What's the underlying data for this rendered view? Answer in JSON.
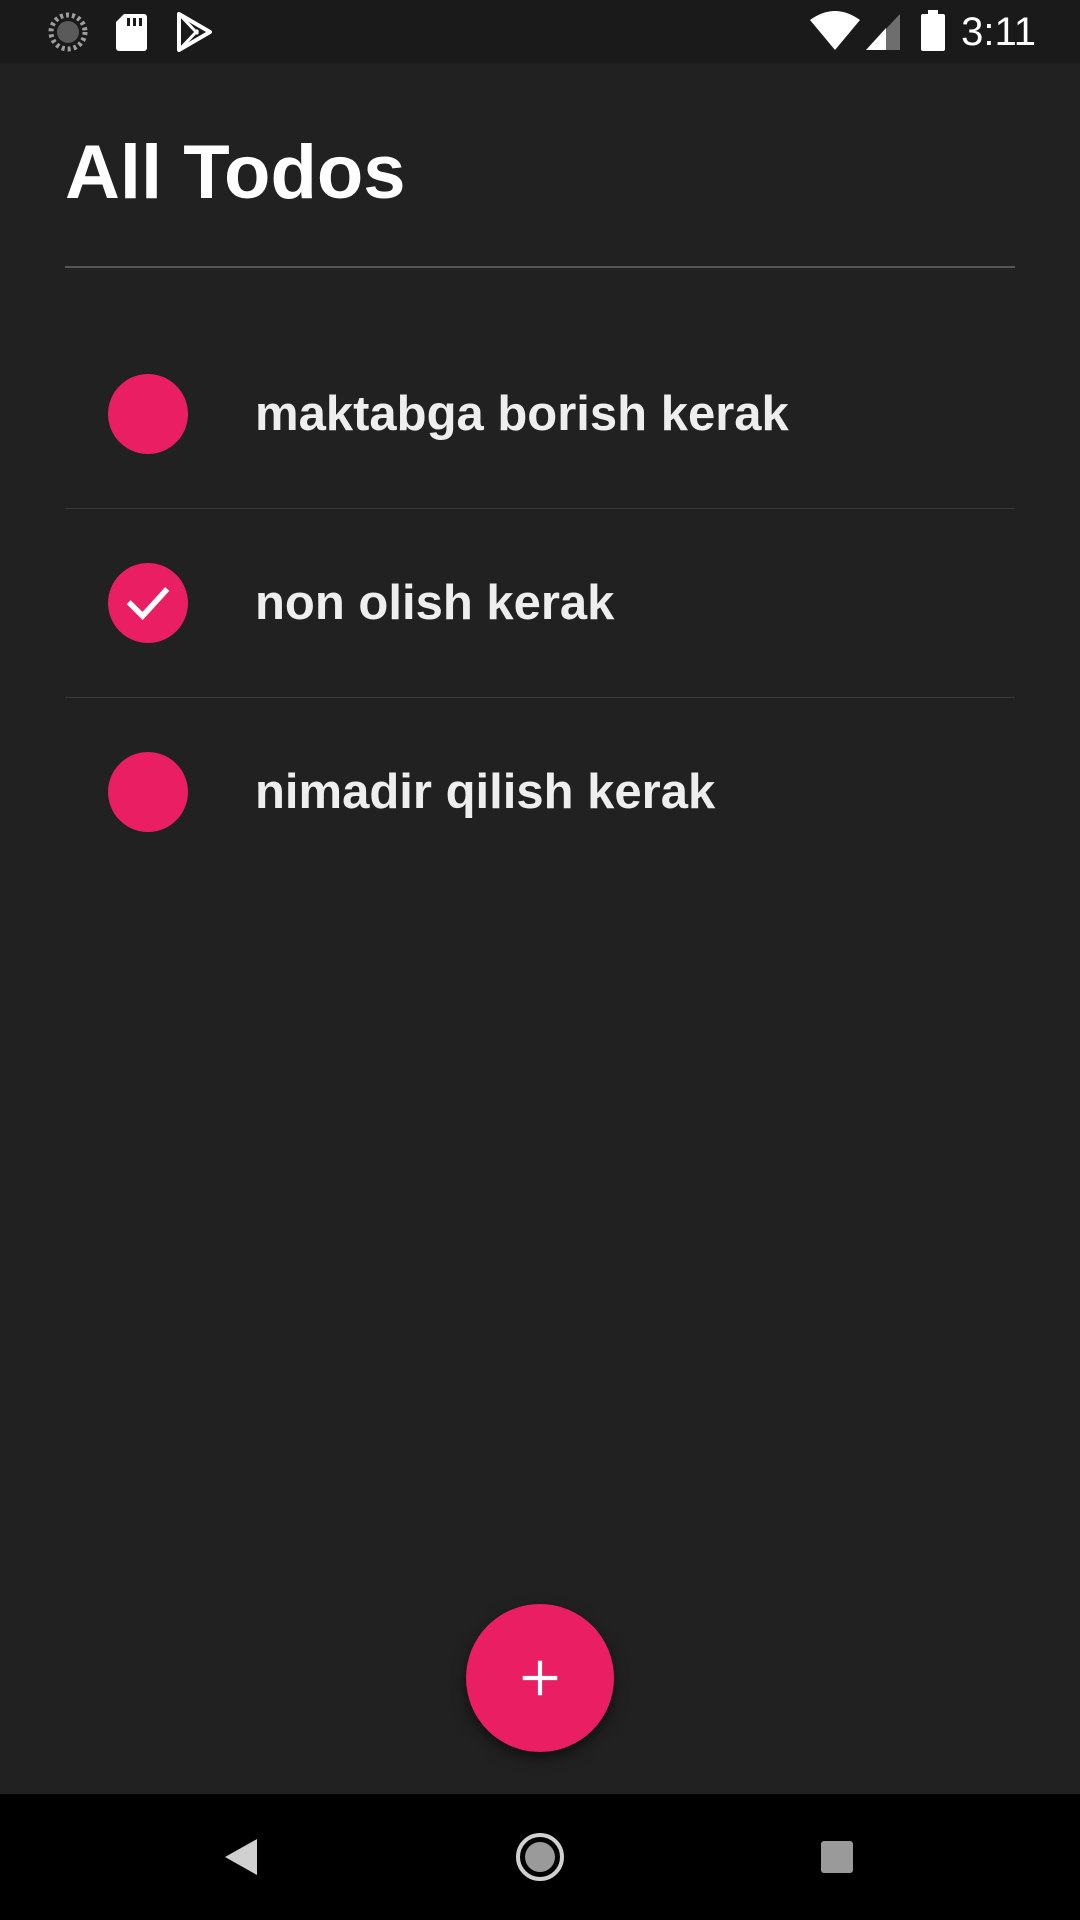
{
  "status_bar": {
    "time": "3:11",
    "left_icons": [
      "loading-icon",
      "sd-card-icon",
      "play-store-icon"
    ],
    "right_icons": [
      "wifi-icon",
      "cell-signal-icon",
      "battery-icon"
    ]
  },
  "header": {
    "title": "All Todos"
  },
  "todos": [
    {
      "text": "maktabga borish kerak",
      "done": false
    },
    {
      "text": "non olish kerak",
      "done": true
    },
    {
      "text": "nimadir qilish kerak",
      "done": false
    }
  ],
  "fab": {
    "icon": "plus-icon"
  },
  "nav_bar": {
    "icons": [
      "back-icon",
      "home-icon",
      "recents-icon"
    ]
  },
  "colors": {
    "accent": "#e91e63",
    "background": "#212121",
    "text": "#eeeeee"
  }
}
